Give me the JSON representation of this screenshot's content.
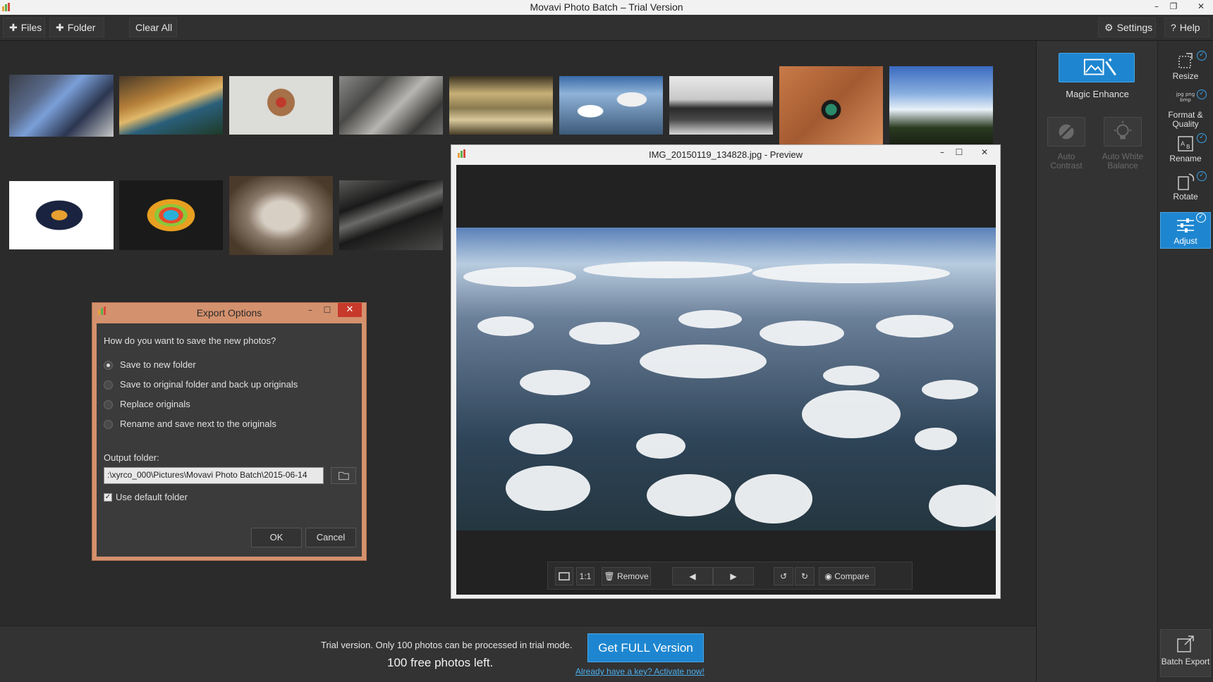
{
  "window": {
    "title": "Movavi Photo Batch – Trial Version",
    "controls": [
      "–",
      "❐",
      "✕"
    ]
  },
  "toolbar": {
    "files_label": "Files",
    "folder_label": "Folder",
    "clear_label": "Clear All",
    "settings_label": "Settings",
    "help_label": "Help"
  },
  "thumbnails": [
    {
      "name": "thumb-tv-screen"
    },
    {
      "name": "thumb-beach-sunset"
    },
    {
      "name": "thumb-toy-dog"
    },
    {
      "name": "thumb-rocks"
    },
    {
      "name": "thumb-hall-interior"
    },
    {
      "name": "thumb-clouds"
    },
    {
      "name": "thumb-desk-monitors"
    },
    {
      "name": "thumb-drone"
    },
    {
      "name": "thumb-sky-trees"
    },
    {
      "name": "thumb-mug"
    },
    {
      "name": "thumb-phone"
    },
    {
      "name": "thumb-cat"
    },
    {
      "name": "thumb-ram-modules"
    }
  ],
  "enhance": {
    "magic_label": "Magic Enhance",
    "auto_contrast_label": "Auto Contrast",
    "auto_white_balance_label": "Auto White Balance"
  },
  "tools": {
    "resize": "Resize",
    "format": "Format & Quality",
    "rename": "Rename",
    "rotate": "Rotate",
    "adjust": "Adjust",
    "format_icon_text": "jpg png bmp"
  },
  "preview": {
    "title": "IMG_20150119_134828.jpg - Preview",
    "one_to_one": "1:1",
    "remove_label": "Remove",
    "compare_label": "Compare"
  },
  "export_dialog": {
    "title": "Export Options",
    "question": "How do you want to save the new photos?",
    "options": [
      {
        "label": "Save to new folder",
        "selected": true
      },
      {
        "label": "Save to original folder and back up originals",
        "selected": false
      },
      {
        "label": "Replace originals",
        "selected": false
      },
      {
        "label": "Rename and save next to the originals",
        "selected": false
      }
    ],
    "output_label": "Output folder:",
    "output_value": ":\\xyrco_000\\Pictures\\Movavi Photo Batch\\2015-06-14",
    "use_default_label": "Use default folder",
    "use_default_checked": true,
    "ok_label": "OK",
    "cancel_label": "Cancel"
  },
  "bottom": {
    "trial_text": "Trial version. Only 100 photos can be processed in trial mode.",
    "free_left": "100 free photos left.",
    "get_full_label": "Get FULL Version",
    "activate_label": "Already have a key? Activate now!",
    "batch_export_label": "Batch Export"
  },
  "colors": {
    "accent": "#1e86d0",
    "dialog_border": "#d4916d",
    "link": "#4ab0f0"
  }
}
